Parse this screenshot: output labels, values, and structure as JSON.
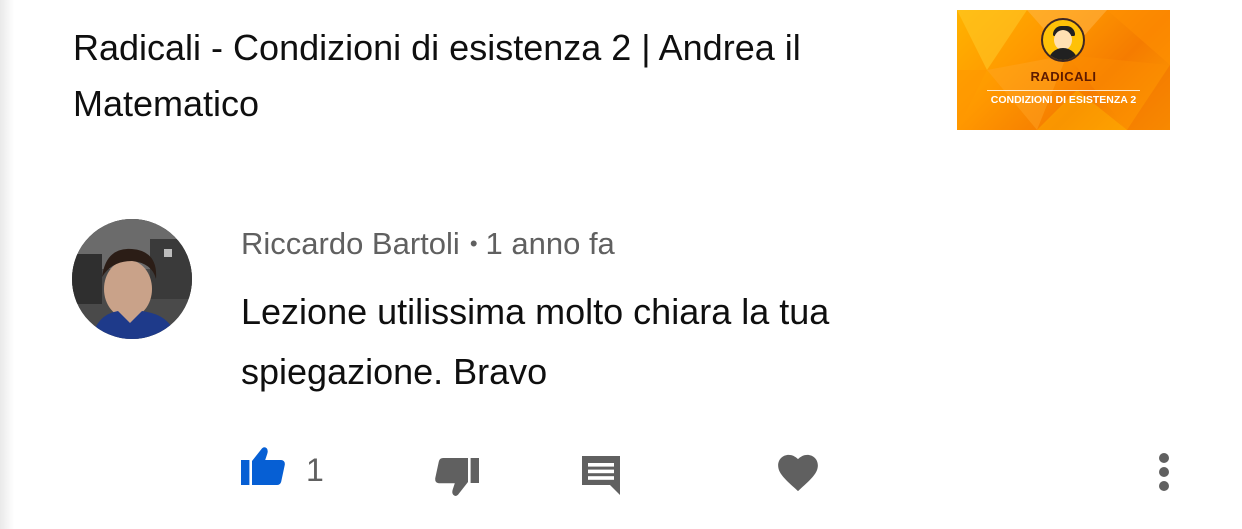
{
  "video": {
    "title": "Radicali - Condizioni di esistenza 2 | Andrea il Matematico",
    "thumbnail": {
      "title": "RADICALI",
      "subtitle": "CONDIZIONI DI ESISTENZA 2",
      "accent": "#ff9800"
    }
  },
  "comment": {
    "author": "Riccardo Bartoli",
    "separator": "•",
    "time": "1 anno fa",
    "text": "Lezione utilissima molto chiara la tua spiegazione. Bravo",
    "likes": "1"
  },
  "actions": {
    "like_icon": "thumbs-up-icon",
    "dislike_icon": "thumbs-down-icon",
    "reply_icon": "comment-icon",
    "heart_icon": "heart-icon",
    "more_icon": "more-vertical-icon",
    "like_color": "#065fd4",
    "icon_color": "#606060"
  }
}
